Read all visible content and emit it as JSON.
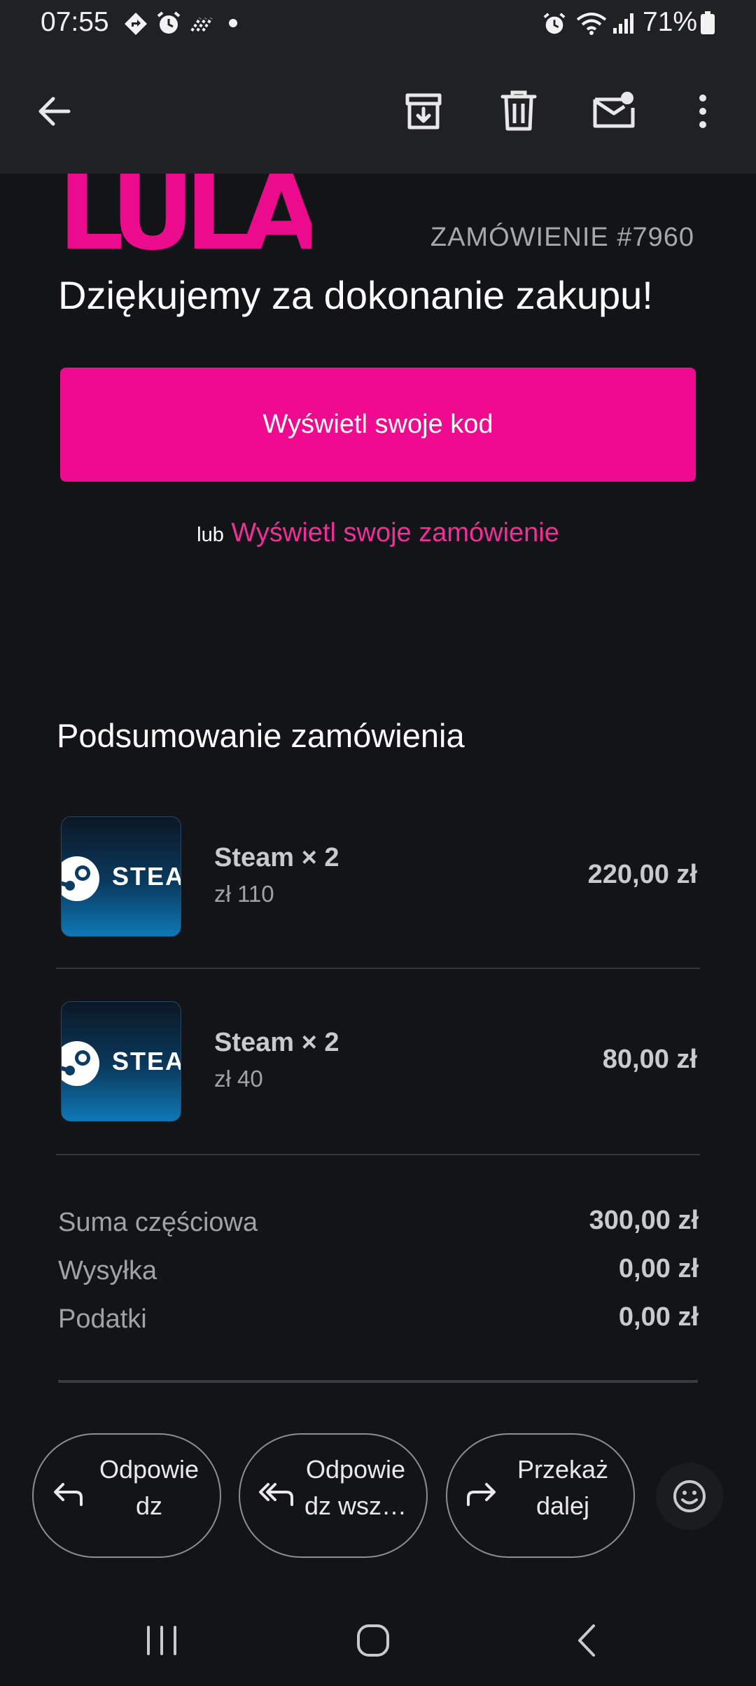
{
  "status_bar": {
    "time": "07:55",
    "battery_text": "71%",
    "left_icons": [
      "navigation-icon",
      "alarm-icon",
      "stripes-icon",
      "dot-icon"
    ],
    "right_icons": [
      "alarm-icon",
      "wifi-icon",
      "signal-icon",
      "battery-icon"
    ]
  },
  "app_bar": {
    "icons": [
      "back-arrow-icon",
      "archive-icon",
      "delete-icon",
      "mark-unread-icon",
      "more-options-icon"
    ]
  },
  "email": {
    "brand": "LULA",
    "order_number": "ZAMÓWIENIE #7960",
    "thanks": "Dziękujemy za dokonanie zakupu!",
    "cta_label": "Wyświetl swoje kod",
    "or_word": "lub",
    "view_order_link": "Wyświetl swoje zamówienie",
    "summary_title": "Podsumowanie zamówienia",
    "items": [
      {
        "thumb_text": "STEAM",
        "name": "Steam × 2",
        "unit_price": "zł 110",
        "total": "220,00 zł"
      },
      {
        "thumb_text": "STEAM",
        "name": "Steam × 2",
        "unit_price": "zł 40",
        "total": "80,00 zł"
      }
    ],
    "totals": [
      {
        "label": "Suma częściowa",
        "value": "300,00 zł"
      },
      {
        "label": "Wysyłka",
        "value": "0,00 zł"
      },
      {
        "label": "Podatki",
        "value": "0,00 zł"
      }
    ]
  },
  "actions": {
    "reply": "Odpowie\ndz",
    "reply_all": "Odpowie\ndz wsz…",
    "forward": "Przekaż\ndalej",
    "emoji_icon": "smiley-icon"
  },
  "nav_bar": {
    "icons": [
      "recent-apps-icon",
      "home-icon",
      "nav-back-icon"
    ]
  },
  "colors": {
    "background": "#131418",
    "bar": "#202125",
    "brand_pink": "#ec0a8d",
    "link_pink": "#ef2f9a",
    "steam_blue": "#0f79b7"
  }
}
